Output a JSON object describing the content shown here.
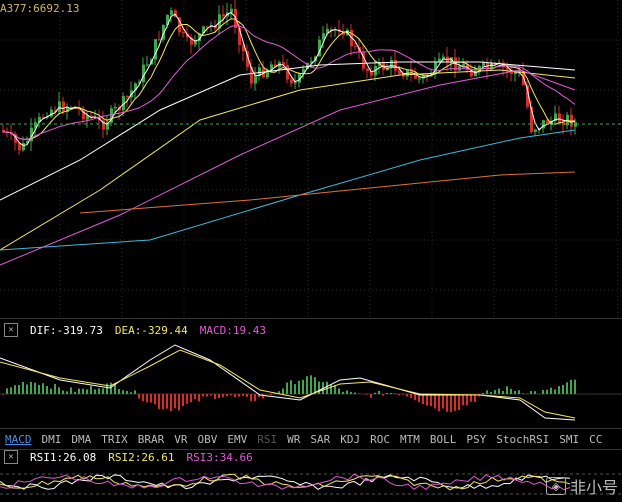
{
  "main": {
    "ma_label": "A377:6692.13"
  },
  "macd": {
    "close_label": "✕",
    "dif": "DIF:-319.73",
    "dea": "DEA:-329.44",
    "macd": "MACD:19.43",
    "colors": {
      "dif": "#ffffff",
      "dea": "#f5e663",
      "macd": "#e05ad6",
      "up": "#3ea84a",
      "down": "#d62c2c"
    }
  },
  "tabs": [
    "MACD",
    "DMI",
    "DMA",
    "TRIX",
    "BRAR",
    "VR",
    "OBV",
    "EMV",
    "RSI",
    "WR",
    "SAR",
    "KDJ",
    "ROC",
    "MTM",
    "BOLL",
    "PSY",
    "StochRSI",
    "SMI",
    "CC"
  ],
  "active_tab": "MACD",
  "dim_tab": "RSI",
  "rsi": {
    "close_label": "✕",
    "rsi1": "RSI1:26.08",
    "rsi2": "RSI2:26.61",
    "rsi3": "RSI3:34.66",
    "colors": {
      "rsi1": "#ffffff",
      "rsi2": "#f5e663",
      "rsi3": "#e05ad6"
    }
  },
  "watermark": {
    "text": "非小号",
    "icon": "logo-icon"
  },
  "colors": {
    "bg": "#000000",
    "candle_up": "#3ea84a",
    "candle_down": "#d62c2c",
    "ma_white": "#ffffff",
    "ma_yellow": "#f5e663",
    "ma_magenta": "#e05ad6",
    "ma_cyan": "#3fb8d8",
    "ma_orange": "#e0703a",
    "grid": "#2a2a2a"
  }
}
